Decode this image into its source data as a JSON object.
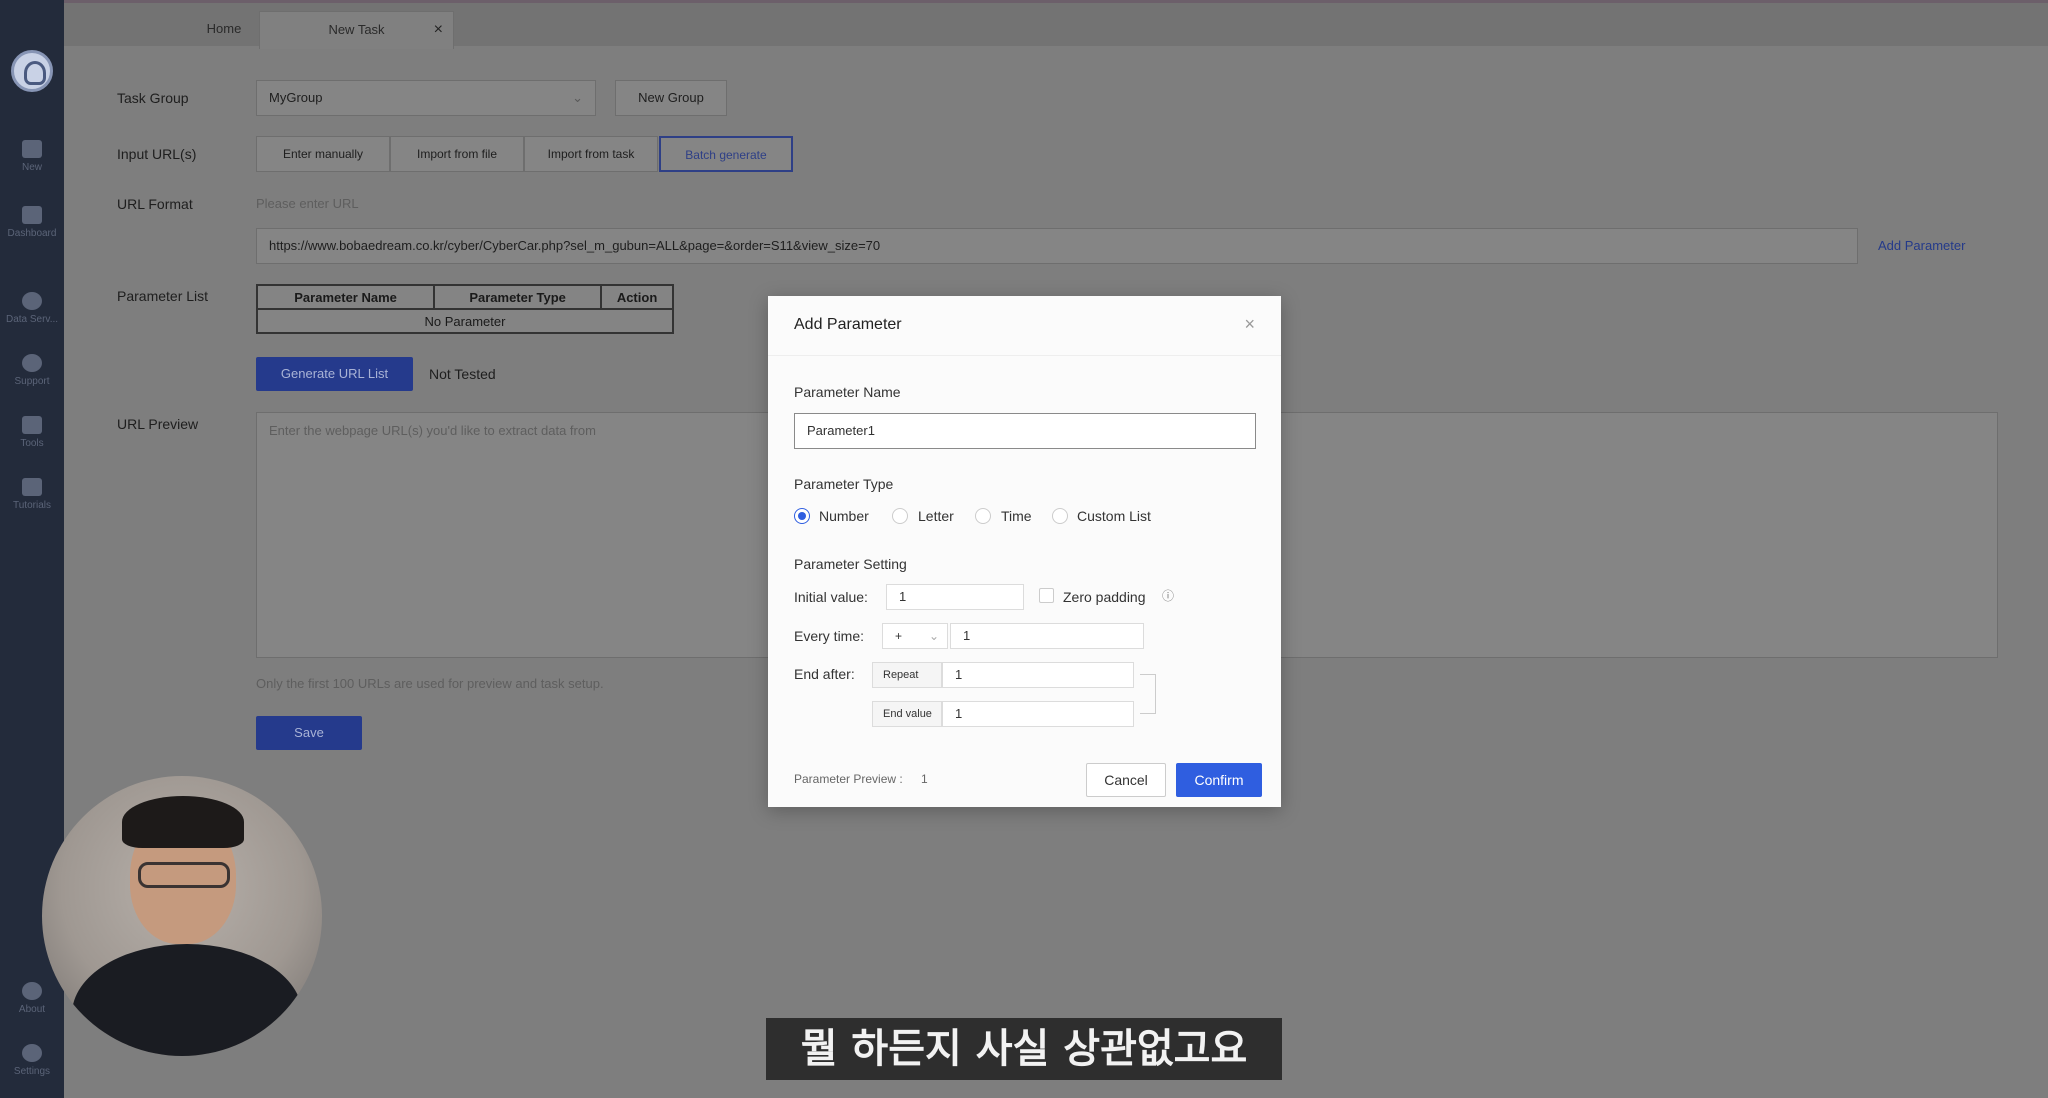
{
  "tabs": [
    {
      "label": "Home"
    },
    {
      "label": "New Task"
    }
  ],
  "sidebar": {
    "items": [
      {
        "label": "New",
        "icon": "plus-square-icon"
      },
      {
        "label": "Dashboard",
        "icon": "bookmark-icon"
      },
      {
        "label": "Data Serv...",
        "icon": "diamond-icon"
      },
      {
        "label": "Support",
        "icon": "headset-icon"
      },
      {
        "label": "Tools",
        "icon": "toolbox-icon"
      },
      {
        "label": "Tutorials",
        "icon": "graduation-cap-icon"
      },
      {
        "label": "About",
        "icon": "info-icon"
      },
      {
        "label": "Settings",
        "icon": "gear-icon"
      }
    ]
  },
  "form": {
    "task_group_label": "Task Group",
    "task_group_value": "MyGroup",
    "new_group_button": "New Group",
    "input_urls_label": "Input URL(s)",
    "input_modes": [
      "Enter manually",
      "Import from file",
      "Import from task",
      "Batch generate"
    ],
    "selected_mode": "Batch generate",
    "url_format_label": "URL Format",
    "url_format_hint": "Please enter URL",
    "url_value": "https://www.bobaedream.co.kr/cyber/CyberCar.php?sel_m_gubun=ALL&page=&order=S11&view_size=70",
    "add_parameter_link": "Add Parameter",
    "parameter_list_label": "Parameter List",
    "param_table_headers": [
      "Parameter Name",
      "Parameter Type",
      "Action"
    ],
    "param_table_empty": "No Parameter",
    "generate_button": "Generate URL List",
    "test_status": "Not Tested",
    "url_preview_label": "URL Preview",
    "url_preview_placeholder": "Enter the webpage URL(s) you'd like to extract data from",
    "preview_note": "Only the first 100 URLs are used for preview and task setup.",
    "save_button": "Save"
  },
  "modal": {
    "title": "Add Parameter",
    "param_name_label": "Parameter Name",
    "param_name_value": "Parameter1",
    "param_type_label": "Parameter Type",
    "param_types": [
      "Number",
      "Letter",
      "Time",
      "Custom List"
    ],
    "selected_type": "Number",
    "setting_label": "Parameter Setting",
    "initial_value_label": "Initial value:",
    "initial_value": "1",
    "zero_padding_label": "Zero padding",
    "every_time_label": "Every time:",
    "every_time_op": "+",
    "every_time_value": "1",
    "end_after_label": "End after:",
    "repeat_label": "Repeat",
    "repeat_value": "1",
    "end_value_label": "End value",
    "end_value": "1",
    "preview_label": "Parameter Preview :",
    "preview_value": "1",
    "cancel_button": "Cancel",
    "confirm_button": "Confirm"
  },
  "subtitle": "뭘 하든지 사실 상관없고요",
  "colors": {
    "accent": "#2f5ee0",
    "sidebar": "#232b3b",
    "overlay": "#7e7e7e"
  }
}
